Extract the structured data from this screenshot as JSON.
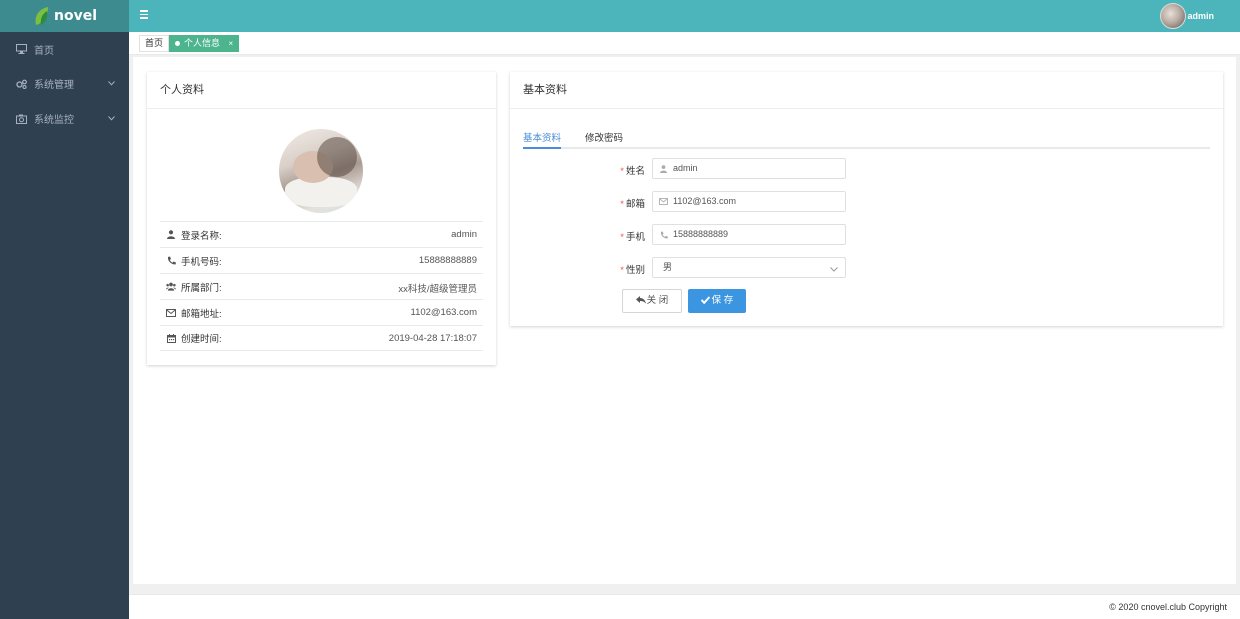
{
  "app": {
    "logo_text": "novel"
  },
  "sidebar": {
    "items": [
      {
        "label": "首页",
        "icon": "monitor-icon"
      },
      {
        "label": "系统管理",
        "icon": "gears-icon"
      },
      {
        "label": "系统监控",
        "icon": "camera-icon"
      }
    ]
  },
  "header": {
    "username": "admin"
  },
  "tabs": {
    "home": "首页",
    "active": "个人信息",
    "close": "×"
  },
  "profile": {
    "title": "个人资料",
    "rows": [
      {
        "label": "登录名称:",
        "value": "admin",
        "icon": "user-icon"
      },
      {
        "label": "手机号码:",
        "value": "15888888889",
        "icon": "phone-icon"
      },
      {
        "label": "所属部门:",
        "value": "xx科技/超级管理员",
        "icon": "users-icon"
      },
      {
        "label": "邮箱地址:",
        "value": "1102@163.com",
        "icon": "envelope-icon"
      },
      {
        "label": "创建时间:",
        "value": "2019-04-28 17:18:07",
        "icon": "calendar-icon"
      }
    ]
  },
  "basic": {
    "title": "基本资料",
    "tabs": {
      "info": "基本资料",
      "password": "修改密码"
    },
    "form": {
      "name_label": "姓名",
      "name_value": "admin",
      "email_label": "邮箱",
      "email_value": "1102@163.com",
      "phone_label": "手机",
      "phone_value": "15888888889",
      "sex_label": "性别",
      "sex_value": "男",
      "required_mark": "*"
    },
    "buttons": {
      "close": "关 闭",
      "save": "保 存"
    }
  },
  "footer": {
    "copyright": "© 2020 cnovel.club Copyright"
  },
  "colors": {
    "sidebar": "#2f4050",
    "header": "#4cb5bb",
    "active_tab": "#4cb58e",
    "primary": "#3c95e0"
  }
}
